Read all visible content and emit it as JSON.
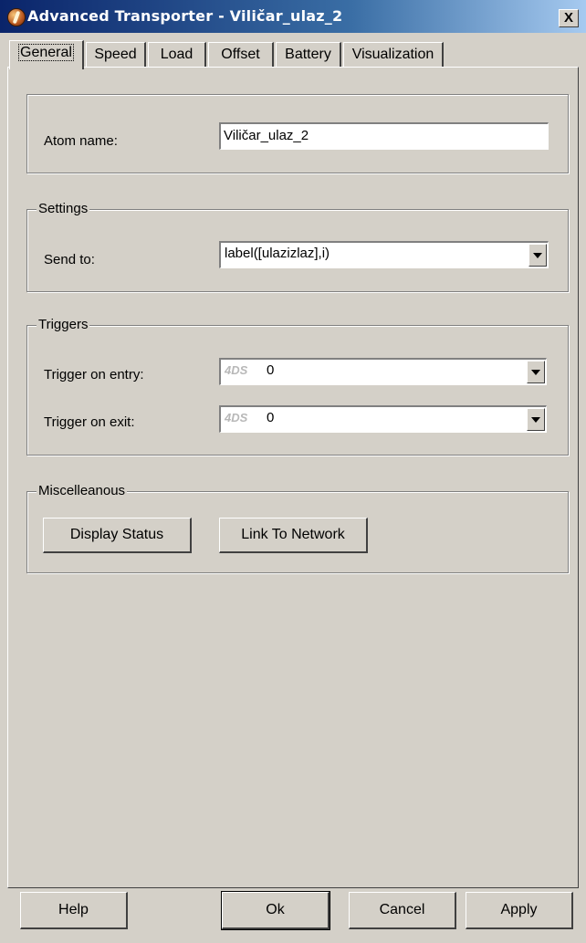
{
  "window": {
    "title": "Advanced Transporter - Viličar_ulaz_2",
    "close_label": "X"
  },
  "tabs": [
    {
      "label": "General",
      "active": true
    },
    {
      "label": "Speed",
      "active": false
    },
    {
      "label": "Load",
      "active": false
    },
    {
      "label": "Offset",
      "active": false
    },
    {
      "label": "Battery",
      "active": false
    },
    {
      "label": "Visualization",
      "active": false
    }
  ],
  "atom": {
    "label": "Atom name:",
    "value": "Viličar_ulaz_2"
  },
  "settings": {
    "title": "Settings",
    "send_to_label": "Send to:",
    "send_to_value": "label([ulazizlaz],i)"
  },
  "triggers": {
    "title": "Triggers",
    "entry_label": "Trigger on entry:",
    "entry_prefix": "4DS",
    "entry_value": "0",
    "exit_label": "Trigger on exit:",
    "exit_prefix": "4DS",
    "exit_value": "0"
  },
  "misc": {
    "title": "Miscelleanous",
    "display_status": "Display Status",
    "link_to_network": "Link To Network"
  },
  "footer": {
    "help": "Help",
    "ok": "Ok",
    "cancel": "Cancel",
    "apply": "Apply"
  },
  "colors": {
    "titlebar_start": "#0a246a",
    "titlebar_end": "#a6caf0",
    "face": "#d4d0c8"
  }
}
